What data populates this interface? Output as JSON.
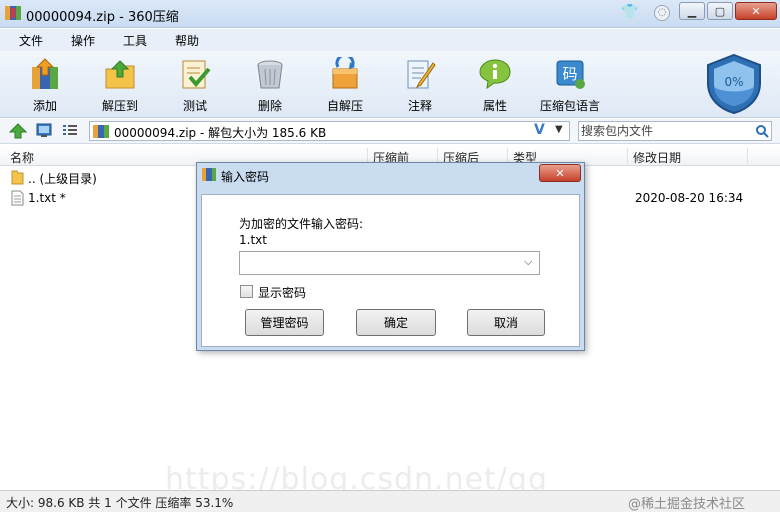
{
  "window": {
    "title": "00000094.zip - 360压缩",
    "min_label": "▁",
    "max_label": "▢",
    "close_label": "✕",
    "skin_glyph": "👕",
    "mini_glyph": "◌"
  },
  "menu": [
    "文件",
    "操作",
    "工具",
    "帮助"
  ],
  "toolbar": [
    {
      "label": "添加",
      "icon": "add-archive-icon"
    },
    {
      "label": "解压到",
      "icon": "extract-icon"
    },
    {
      "label": "测试",
      "icon": "test-icon"
    },
    {
      "label": "删除",
      "icon": "trash-icon"
    },
    {
      "label": "自解压",
      "icon": "self-extract-icon"
    },
    {
      "label": "注释",
      "icon": "comment-icon"
    },
    {
      "label": "属性",
      "icon": "info-icon"
    },
    {
      "label": "压缩包语言",
      "icon": "language-icon"
    }
  ],
  "shield": {
    "percent_text": "0%",
    "fill_fraction": 0
  },
  "address": {
    "path": "00000094.zip - 解包大小为 185.6 KB",
    "v_glyph": "V",
    "arrow": "▼",
    "search_placeholder": "搜索包内文件"
  },
  "columns": [
    "名称",
    "压缩前",
    "压缩后",
    "类型",
    "修改日期"
  ],
  "files": [
    {
      "name": ".. (上级目录)",
      "kind": "folder",
      "date": ""
    },
    {
      "name": "1.txt *",
      "kind": "text",
      "date": "2020-08-20 16:34"
    }
  ],
  "status": {
    "text": "大小: 98.6 KB 共 1 个文件 压缩率 53.1%",
    "watermark": "@稀土掘金技术社区",
    "ghost": "https://blog.csdn.net/qq_"
  },
  "dialog": {
    "title": "输入密码",
    "prompt": "为加密的文件输入密码:",
    "filename": "1.txt",
    "password_value": "",
    "dropdown": "⌵",
    "show_password_label": "显示密码",
    "show_password_checked": false,
    "buttons": {
      "manage": "管理密码",
      "ok": "确定",
      "cancel": "取消"
    },
    "close_label": "✕"
  },
  "colors": {
    "accent": "#3a7cc4",
    "close": "#c7402a",
    "shield": "#2f6fb3"
  }
}
